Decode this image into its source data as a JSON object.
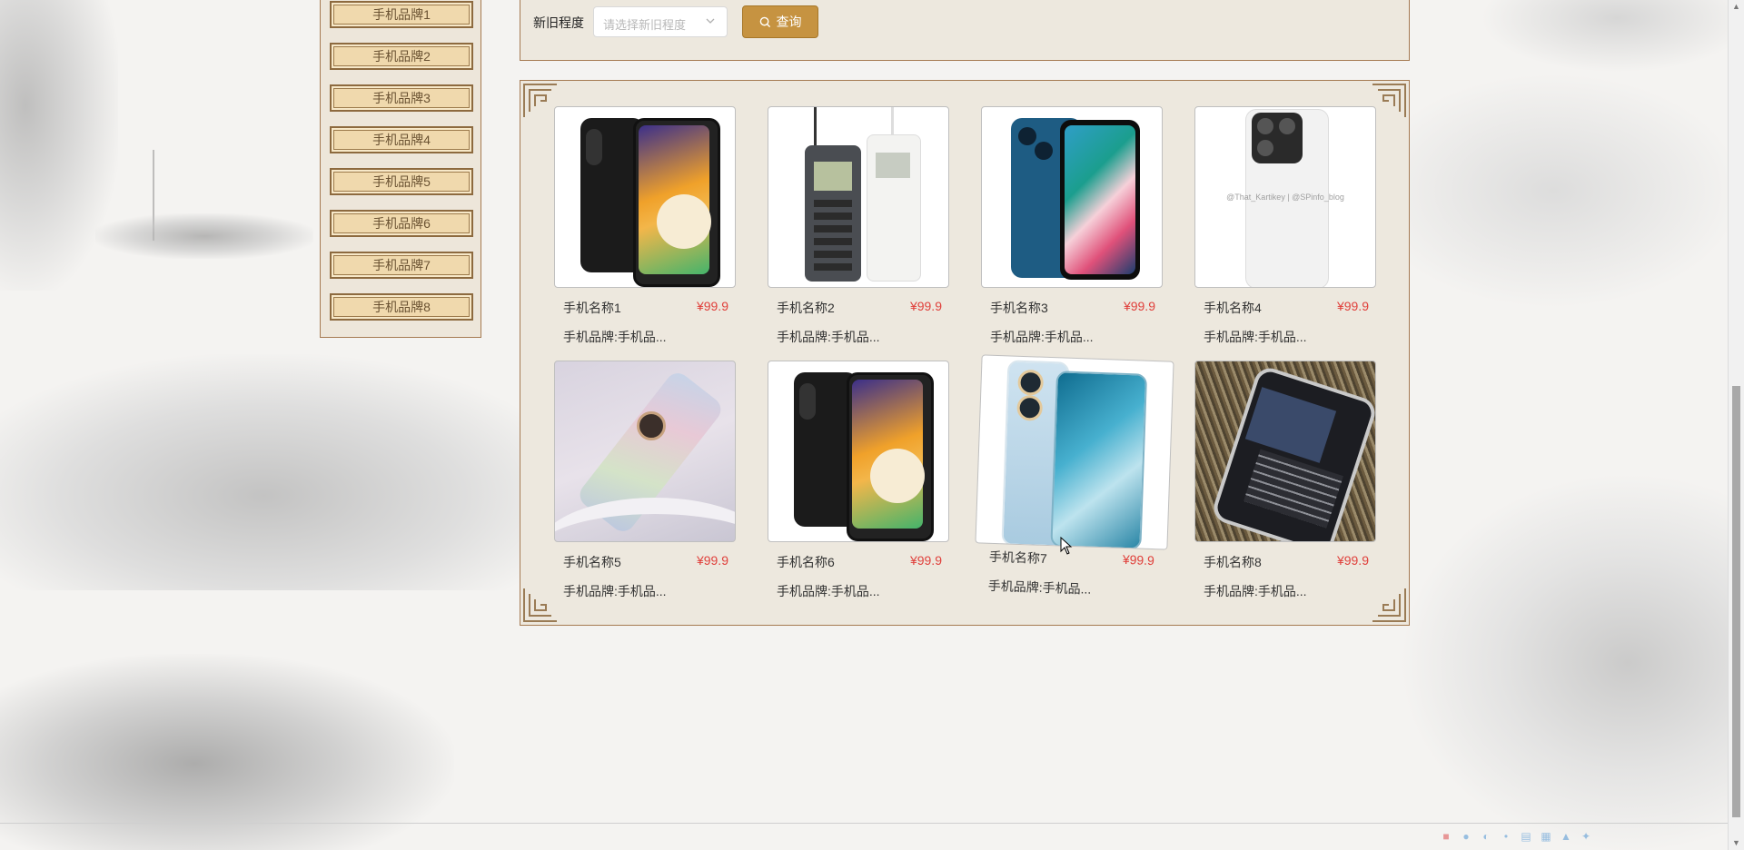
{
  "sidebar": {
    "brands": [
      "手机品牌1",
      "手机品牌2",
      "手机品牌3",
      "手机品牌4",
      "手机品牌5",
      "手机品牌6",
      "手机品牌7",
      "手机品牌8"
    ]
  },
  "filter": {
    "label": "新旧程度",
    "select_placeholder": "请选择新旧程度",
    "query_label": "查询"
  },
  "products": [
    {
      "name": "手机名称1",
      "price": "¥99.9",
      "brand": "手机品牌:手机品...",
      "image": "samsung-phone"
    },
    {
      "name": "手机名称2",
      "price": "¥99.9",
      "brand": "手机品牌:手机品...",
      "image": "retro-brick-phones"
    },
    {
      "name": "手机名称3",
      "price": "¥99.9",
      "brand": "手机品牌:手机品...",
      "image": "iphone-blue"
    },
    {
      "name": "手机名称4",
      "price": "¥99.9",
      "brand": "手机品牌:手机品...",
      "image": "xiaomi-white-back",
      "watermark": "@That_Kartikey | @SPinfo_blog"
    },
    {
      "name": "手机名称5",
      "price": "¥99.9",
      "brand": "手机品牌:手机品...",
      "image": "honor-iridescent"
    },
    {
      "name": "手机名称6",
      "price": "¥99.9",
      "brand": "手机品牌:手机品...",
      "image": "samsung-phone"
    },
    {
      "name": "手机名称7",
      "price": "¥99.9",
      "brand": "手机品牌:手机品...",
      "image": "honor-light-blue"
    },
    {
      "name": "手机名称8",
      "price": "¥99.9",
      "brand": "手机品牌:手机品...",
      "image": "blackberry"
    }
  ],
  "colors": {
    "accent": "#c69341",
    "price": "#e0413c",
    "panel": "#ede8de",
    "border": "#a57a52"
  }
}
